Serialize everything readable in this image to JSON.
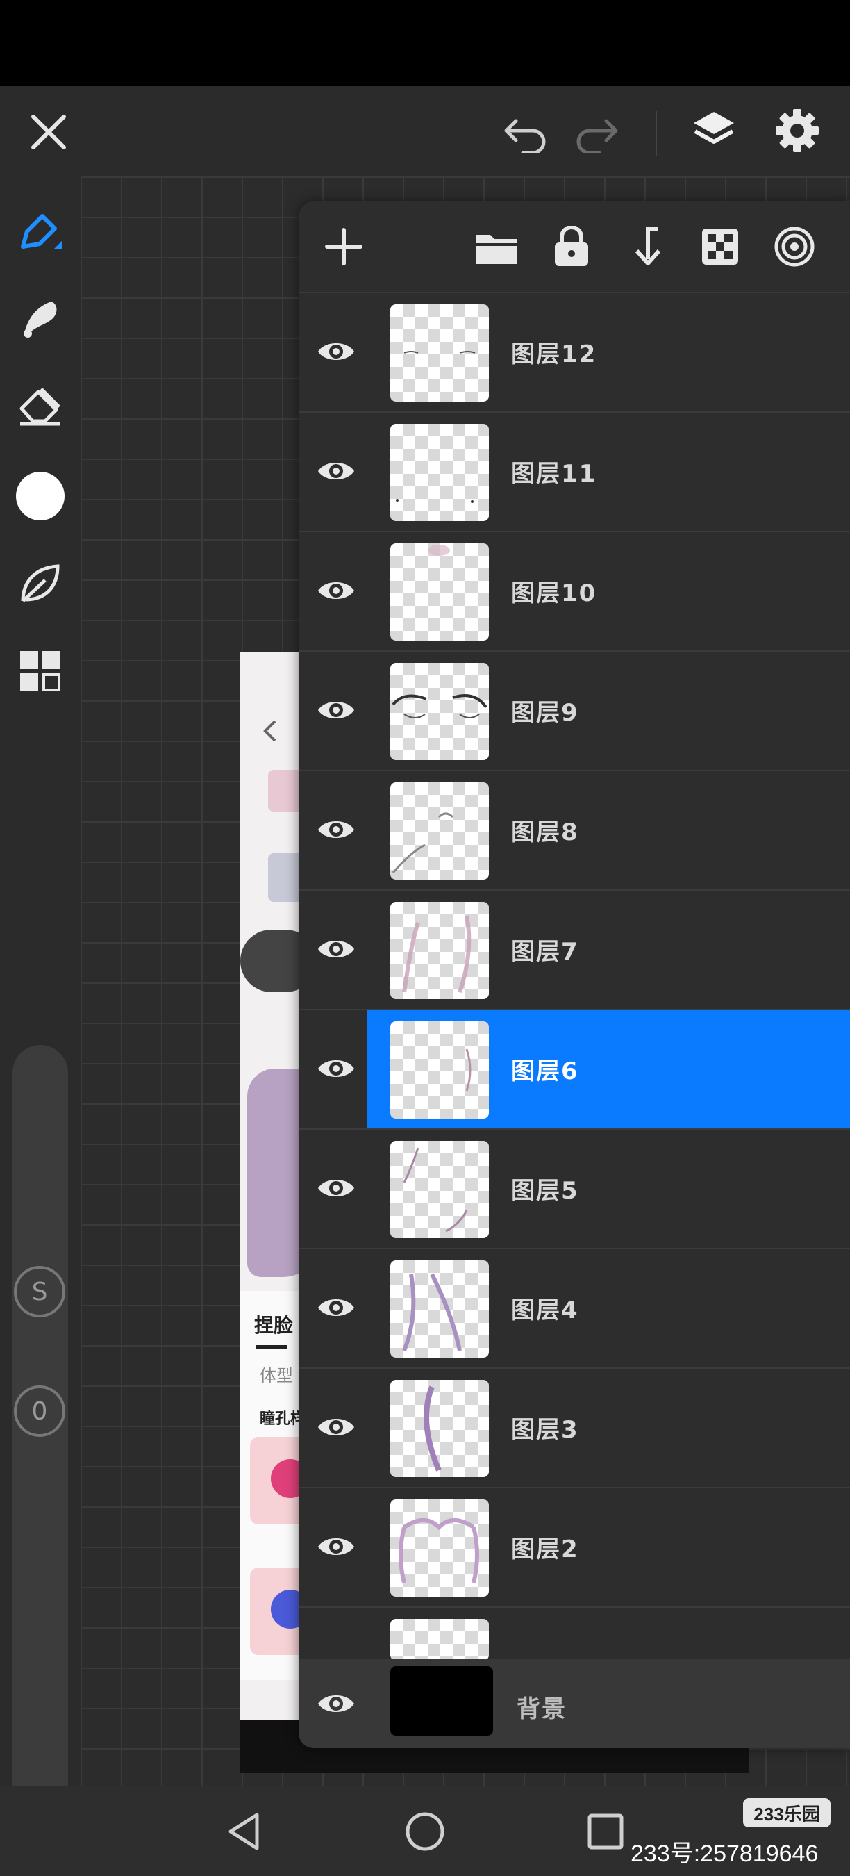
{
  "layers": [
    {
      "name": "图层12",
      "selected": false,
      "visible": true
    },
    {
      "name": "图层11",
      "selected": false,
      "visible": true
    },
    {
      "name": "图层10",
      "selected": false,
      "visible": true
    },
    {
      "name": "图层9",
      "selected": false,
      "visible": true
    },
    {
      "name": "图层8",
      "selected": false,
      "visible": true
    },
    {
      "name": "图层7",
      "selected": false,
      "visible": true
    },
    {
      "name": "图层6",
      "selected": true,
      "visible": true
    },
    {
      "name": "图层5",
      "selected": false,
      "visible": true
    },
    {
      "name": "图层4",
      "selected": false,
      "visible": true
    },
    {
      "name": "图层3",
      "selected": false,
      "visible": true
    },
    {
      "name": "图层2",
      "selected": false,
      "visible": true
    }
  ],
  "background_layer": {
    "name": "背景"
  },
  "sliders": {
    "size_badge": "S",
    "opacity_badge": "0"
  },
  "embedded_app": {
    "tab_face": "捏脸",
    "tab_body": "体型",
    "section": "瞳孔样"
  },
  "watermark": {
    "logo": "233乐园",
    "id_text": "233号:257819646"
  },
  "colors": {
    "accent": "#0A7AFF",
    "panel": "#2D2D2D",
    "toolbar": "#2B2B2B"
  }
}
